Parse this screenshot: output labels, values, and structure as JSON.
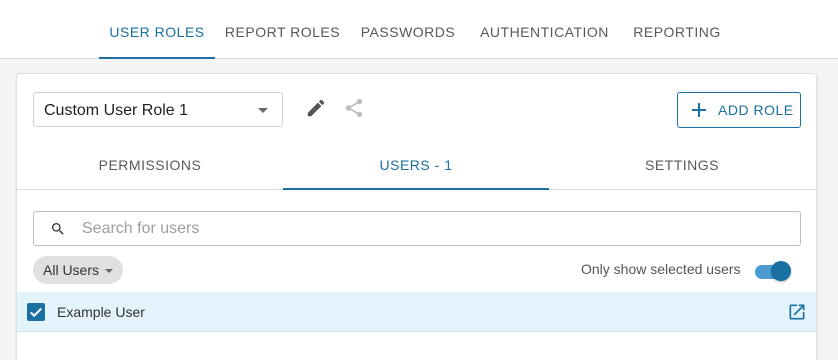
{
  "top_tabs": [
    {
      "label": "USER ROLES",
      "active": true
    },
    {
      "label": "REPORT ROLES",
      "active": false
    },
    {
      "label": "PASSWORDS",
      "active": false
    },
    {
      "label": "AUTHENTICATION",
      "active": false
    },
    {
      "label": "REPORTING",
      "active": false
    }
  ],
  "role": {
    "selected": "Custom User Role 1",
    "edit_icon": "pencil-icon",
    "share_icon": "share-icon",
    "add_label": "ADD ROLE"
  },
  "sub_tabs": [
    {
      "label": "PERMISSIONS",
      "active": false
    },
    {
      "label": "USERS - 1",
      "active": true
    },
    {
      "label": "SETTINGS",
      "active": false
    }
  ],
  "users": {
    "search_placeholder": "Search for users",
    "search_value": "",
    "filter_chip": "All Users",
    "toggle_label": "Only show selected users",
    "toggle_on": true,
    "rows": [
      {
        "name": "Example User",
        "selected": true
      }
    ]
  },
  "colors": {
    "accent": "#1a6fa3",
    "row_highlight": "#e3f3fb"
  }
}
